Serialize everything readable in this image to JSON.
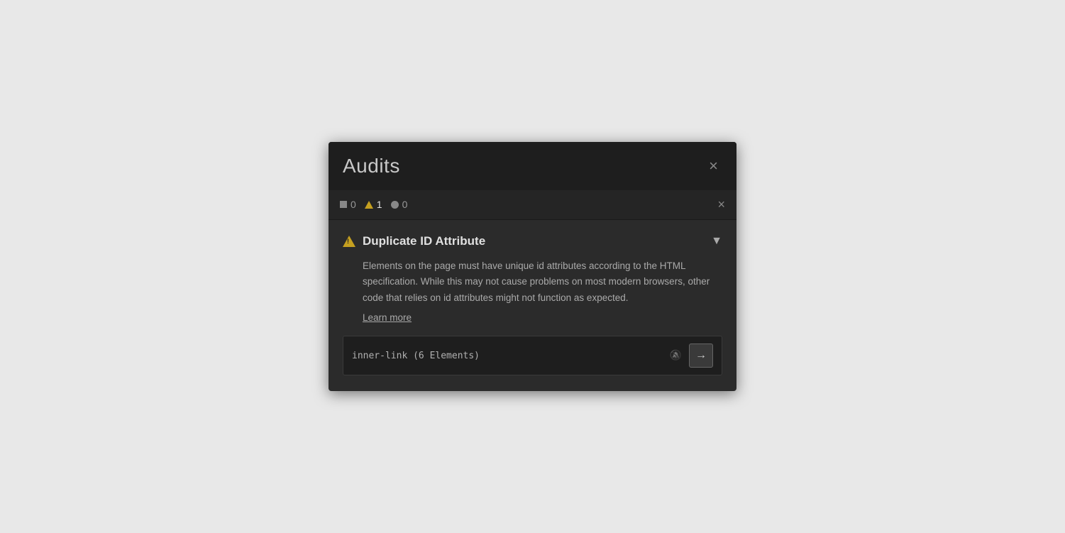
{
  "panel": {
    "title": "Audits",
    "close_label": "×"
  },
  "filter_bar": {
    "error_count": "0",
    "warning_count": "1",
    "info_count": "0",
    "clear_label": "×"
  },
  "audit": {
    "title": "Duplicate ID Attribute",
    "description": "Elements on the page must have unique id attributes according to the HTML specification. While this may not cause problems on most modern browsers, other code that relies on id attributes might not function as expected.",
    "learn_more_label": "Learn more",
    "result_label": "inner-link (6 Elements)"
  },
  "icons": {
    "chevron_down": "▼",
    "mute": "🔕",
    "navigate": "→"
  }
}
